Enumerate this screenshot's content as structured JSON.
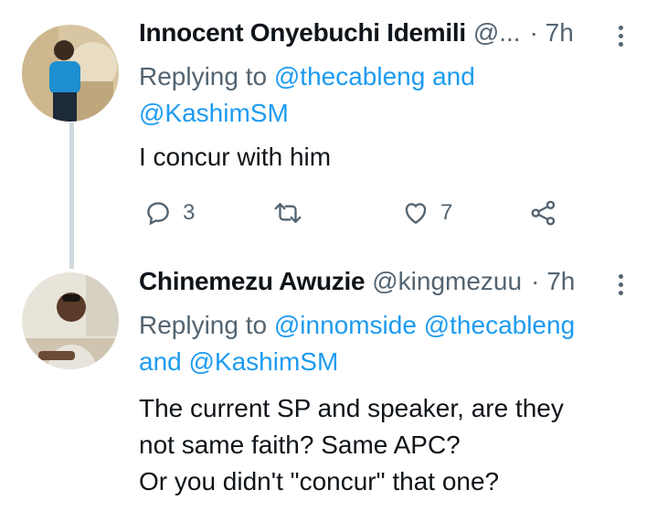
{
  "tweets": [
    {
      "name": "Innocent Onyebuchi Idemili",
      "handle": "@...",
      "time": "· 7h",
      "replying_prefix": "Replying to ",
      "mention1": "@thecableng",
      "and_word": " and",
      "mention2": "@KashimSM",
      "text": "I concur with him",
      "actions": {
        "reply_count": "3",
        "like_count": "7"
      }
    },
    {
      "name": "Chinemezu Awuzie",
      "handle": "@kingmezuu",
      "time": "· 7h",
      "replying_prefix": "Replying to ",
      "mention1": "@innomside",
      "mention2": "@thecableng",
      "and_word": "and ",
      "mention3": "@KashimSM",
      "text_lines": [
        "The current SP and speaker, are they",
        "not same faith? Same APC?",
        "Or you didn't \"concur\" that one?"
      ]
    }
  ],
  "icons": [
    "reply-icon",
    "retweet-icon",
    "like-icon",
    "share-icon",
    "more-icon"
  ],
  "colors": {
    "link": "#1d9bf0",
    "muted": "#536471",
    "text": "#0f1419",
    "thread_line": "#cfd9de"
  }
}
